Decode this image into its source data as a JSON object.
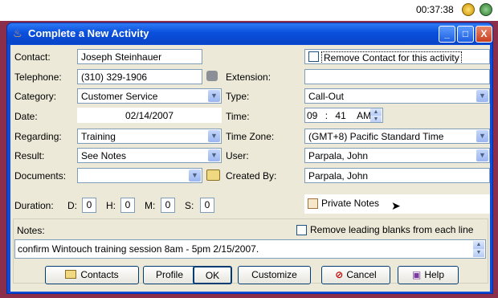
{
  "taskbar": {
    "clock": "00:37:38"
  },
  "window": {
    "title": "Complete a New Activity",
    "minimize": "_",
    "maximize": "□",
    "close": "X"
  },
  "form": {
    "contact": {
      "label": "Contact:",
      "value": "Joseph Steinhauer"
    },
    "remove_contact": {
      "label": "Remove Contact for this activity",
      "checked": false
    },
    "telephone": {
      "label": "Telephone:",
      "value": "(310) 329-1906"
    },
    "extension": {
      "label": "Extension:",
      "value": ""
    },
    "category": {
      "label": "Category:",
      "value": "Customer Service"
    },
    "type": {
      "label": "Type:",
      "value": "Call-Out"
    },
    "date": {
      "label": "Date:",
      "value": "02/14/2007"
    },
    "time": {
      "label": "Time:",
      "hour": "09",
      "minute": "41",
      "ampm": "AM",
      "sep": ":"
    },
    "regarding": {
      "label": "Regarding:",
      "value": "Training"
    },
    "timezone": {
      "label": "Time Zone:",
      "value": "(GMT+8) Pacific Standard Time"
    },
    "result": {
      "label": "Result:",
      "value": "See Notes"
    },
    "user": {
      "label": "User:",
      "value": "Parpala, John"
    },
    "documents": {
      "label": "Documents:",
      "value": ""
    },
    "created_by": {
      "label": "Created By:",
      "value": "Parpala, John"
    },
    "duration": {
      "label": "Duration:",
      "d_label": "D:",
      "d": "0",
      "h_label": "H:",
      "h": "0",
      "m_label": "M:",
      "m": "0",
      "s_label": "S:",
      "s": "0"
    },
    "private_notes": {
      "label": "Private Notes",
      "checked": false
    },
    "notes": {
      "label": "Notes:",
      "value": "confirm Wintouch training session 8am - 5pm 2/15/2007."
    },
    "remove_blanks": {
      "label": "Remove leading blanks from each line",
      "checked": false
    }
  },
  "buttons": {
    "contacts": "Contacts",
    "profile": "Profile",
    "ok": "OK",
    "customize": "Customize",
    "cancel": "Cancel",
    "help": "Help"
  },
  "colors": {
    "title_blue": "#0a4fdc",
    "dialog_bg": "#ece9d8",
    "desktop": "#8b2e4b"
  }
}
